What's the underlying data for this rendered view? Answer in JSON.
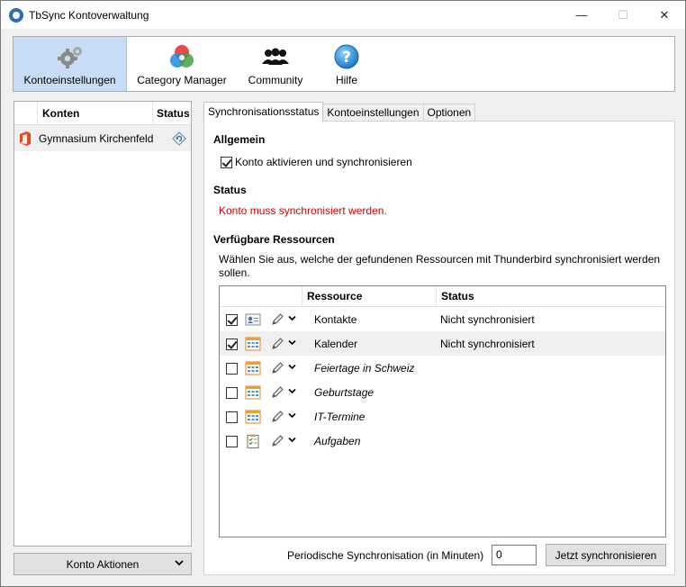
{
  "window": {
    "title": "TbSync Kontoverwaltung",
    "minimize": "—",
    "maximize": "☐",
    "close": "✕"
  },
  "toolbar": {
    "items": [
      {
        "label": "Kontoeinstellungen",
        "icon": "gears-icon"
      },
      {
        "label": "Category Manager",
        "icon": "category-circles-icon"
      },
      {
        "label": "Community",
        "icon": "people-icon"
      },
      {
        "label": "Hilfe",
        "icon": "help-icon"
      }
    ]
  },
  "accounts": {
    "col_konten": "Konten",
    "col_status": "Status",
    "rows": [
      {
        "name": "Gymnasium Kirchenfeld",
        "icon": "office-icon",
        "status_icon": "sync-needed-icon"
      }
    ],
    "actions_label": "Konto Aktionen"
  },
  "tabs": [
    "Synchronisationsstatus",
    "Kontoeinstellungen",
    "Optionen"
  ],
  "main": {
    "general_title": "Allgemein",
    "enable_label": "Konto aktivieren und synchronisieren",
    "enable_checked": true,
    "status_title": "Status",
    "status_text": "Konto muss synchronisiert werden.",
    "status_color": "#d00000",
    "resources_title": "Verfügbare Ressourcen",
    "resources_desc": "Wählen Sie aus, welche der gefundenen Ressourcen mit Thunderbird synchronisiert werden sollen.",
    "table_head_resource": "Ressource",
    "table_head_status": "Status",
    "resources": [
      {
        "name": "Kontakte",
        "status": "Nicht synchronisiert",
        "checked": true,
        "type": "contacts-icon",
        "italic": false
      },
      {
        "name": "Kalender",
        "status": "Nicht synchronisiert",
        "checked": true,
        "type": "calendar-icon",
        "italic": false
      },
      {
        "name": "Feiertage in Schweiz",
        "status": "",
        "checked": false,
        "type": "calendar-icon",
        "italic": true
      },
      {
        "name": "Geburtstage",
        "status": "",
        "checked": false,
        "type": "calendar-icon",
        "italic": true
      },
      {
        "name": "IT-Termine",
        "status": "",
        "checked": false,
        "type": "calendar-icon",
        "italic": true
      },
      {
        "name": "Aufgaben",
        "status": "",
        "checked": false,
        "type": "tasks-icon",
        "italic": true
      }
    ],
    "periodic_label": "Periodische Synchronisation (in Minuten)",
    "periodic_value": "0",
    "sync_button": "Jetzt synchronisieren"
  }
}
